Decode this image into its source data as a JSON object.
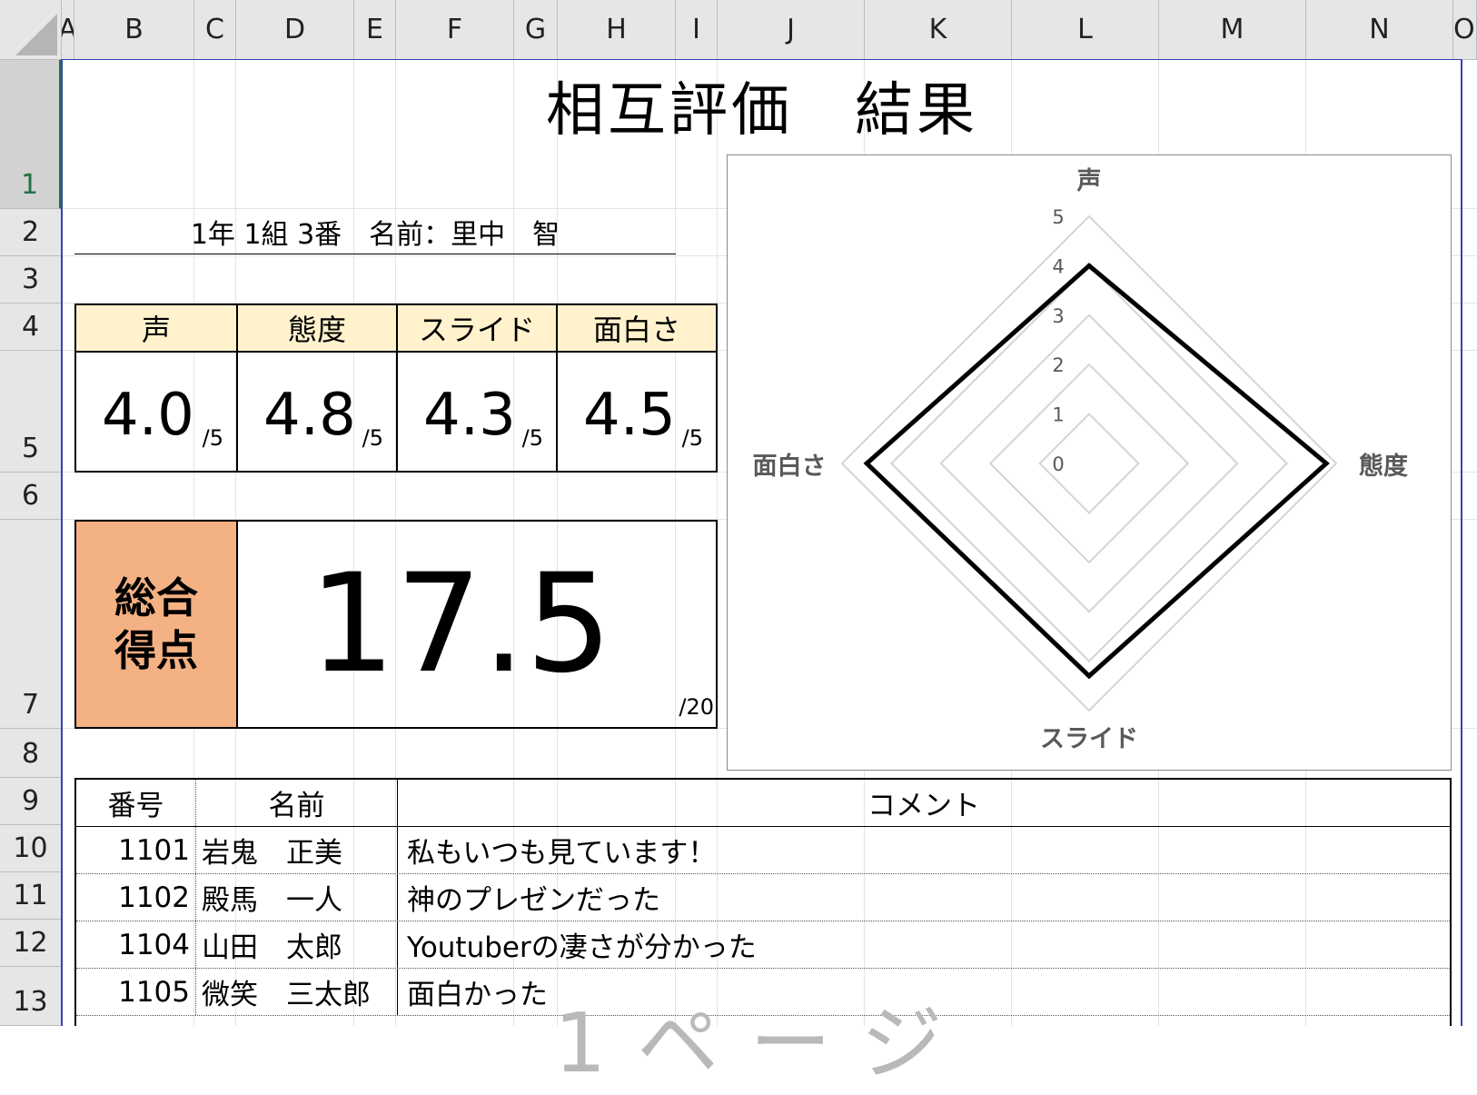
{
  "columns": [
    "A",
    "B",
    "C",
    "D",
    "E",
    "F",
    "G",
    "H",
    "I",
    "J",
    "K",
    "L",
    "M",
    "N",
    "O"
  ],
  "rows": [
    "1",
    "2",
    "3",
    "4",
    "5",
    "6",
    "7",
    "8",
    "9",
    "10",
    "11",
    "12",
    "13"
  ],
  "title": "相互評価　結果",
  "student_info": "1年 1組 3番　名前：里中　智",
  "scores": [
    {
      "label": "声",
      "value": "4.0",
      "max": "/5"
    },
    {
      "label": "態度",
      "value": "4.8",
      "max": "/5"
    },
    {
      "label": "スライド",
      "value": "4.3",
      "max": "/5"
    },
    {
      "label": "面白さ",
      "value": "4.5",
      "max": "/5"
    }
  ],
  "total": {
    "label_line1": "総合",
    "label_line2": "得点",
    "value": "17.5",
    "max": "/20"
  },
  "chart_data": {
    "type": "radar",
    "axes": [
      "声",
      "態度",
      "スライド",
      "面白さ"
    ],
    "values": [
      4.0,
      4.8,
      4.3,
      4.5
    ],
    "range": [
      0,
      5
    ],
    "ticks": [
      "0",
      "1",
      "2",
      "3",
      "4",
      "5"
    ],
    "series_color": "#000000",
    "grid_color": "#d4d4d4"
  },
  "comments": {
    "headers": [
      "番号",
      "名前",
      "コメント"
    ],
    "rows": [
      {
        "id": "1101",
        "name": "岩鬼　正美",
        "comment": "私もいつも見ています！"
      },
      {
        "id": "1102",
        "name": "殿馬　一人",
        "comment": "神のプレゼンだった"
      },
      {
        "id": "1104",
        "name": "山田　太郎",
        "comment": "Youtuberの凄さが分かった"
      },
      {
        "id": "1105",
        "name": "微笑　三太郎",
        "comment": "面白かった"
      }
    ]
  },
  "watermark": "1ページ",
  "colors": {
    "score_header": "#fff2cc",
    "total_label": "#f4b183",
    "page_border": "#3b3fb5",
    "selected_row": "#217346"
  }
}
